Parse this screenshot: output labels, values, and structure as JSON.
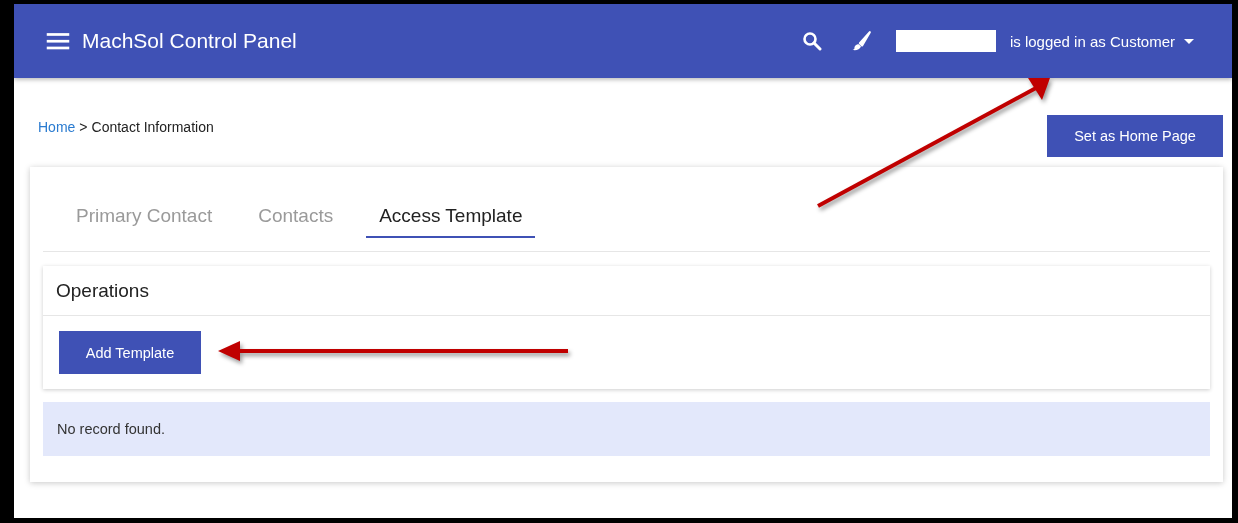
{
  "header": {
    "title": "MachSol Control Panel",
    "login_text": "is logged in as Customer"
  },
  "breadcrumb": {
    "link": "Home",
    "separator": ">",
    "current": "Contact Information"
  },
  "home_button": "Set as Home Page",
  "tabs": [
    {
      "label": "Primary Contact",
      "selected": false
    },
    {
      "label": "Contacts",
      "selected": false
    },
    {
      "label": "Access Template",
      "selected": true
    }
  ],
  "operations": {
    "title": "Operations",
    "button": "Add Template"
  },
  "empty_message": "No record found."
}
